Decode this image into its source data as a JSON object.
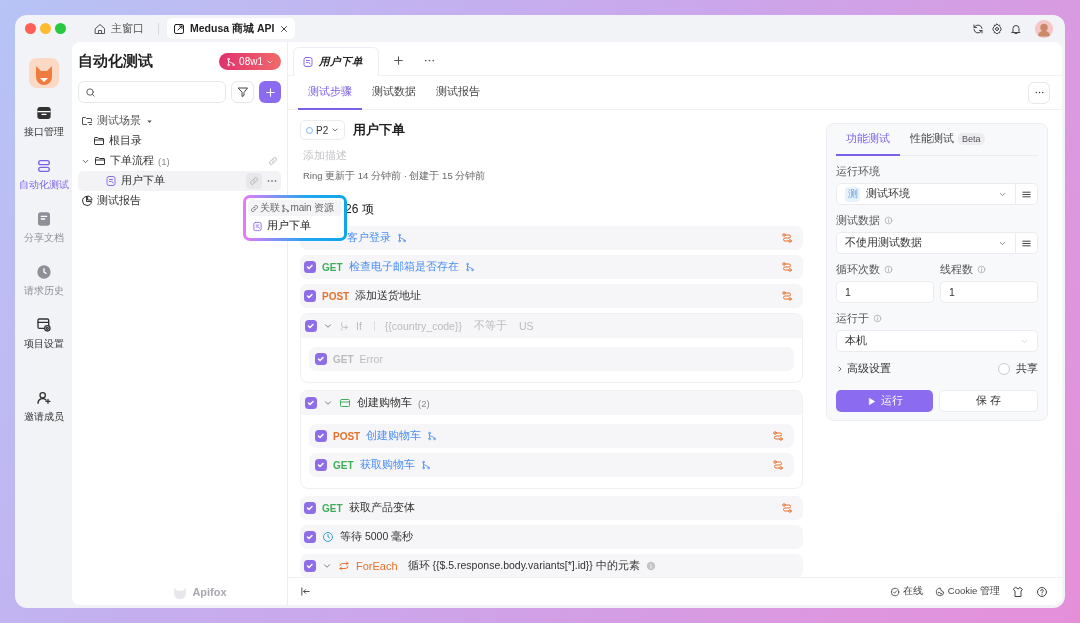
{
  "window": {
    "tabs": [
      {
        "kind": "home",
        "label": "主窗口",
        "selected": false,
        "closable": false
      },
      {
        "kind": "project",
        "label": "Medusa 商城 API",
        "selected": true,
        "closable": true
      }
    ]
  },
  "nav": [
    {
      "label": "接口管理",
      "selected": false,
      "disabled": false
    },
    {
      "label": "自动化测试",
      "selected": true,
      "disabled": false
    },
    {
      "label": "分享文档",
      "selected": false,
      "disabled": true
    },
    {
      "label": "请求历史",
      "selected": false,
      "disabled": true
    },
    {
      "label": "项目设置",
      "selected": false,
      "disabled": false
    },
    {
      "label": "邀请成员",
      "selected": false,
      "disabled": false
    }
  ],
  "sidebar": {
    "title": "自动化测试",
    "branch": "08w1",
    "footer_logo": "Apifox",
    "tree": [
      {
        "kind": "section",
        "label": "测试场景",
        "expanded": true,
        "children": [
          {
            "kind": "folder",
            "label": "根目录",
            "selected": false
          },
          {
            "kind": "folder",
            "label": "下单流程",
            "count": "(1)",
            "expanded": true,
            "selected": false,
            "children": [
              {
                "kind": "scenario",
                "label": "用户下单",
                "selected": true
              }
            ]
          }
        ]
      },
      {
        "kind": "report",
        "label": "测试报告"
      }
    ]
  },
  "popup": {
    "link_label": "关联",
    "link_target": "main 资源",
    "item": "用户下单"
  },
  "editor": {
    "tabs": [
      {
        "label": "用户下单",
        "selected": true
      }
    ],
    "subtabs": [
      {
        "label": "测试步骤",
        "selected": true
      },
      {
        "label": "测试数据",
        "selected": false
      },
      {
        "label": "测试报告",
        "selected": false
      }
    ],
    "priority": "P2",
    "title": "用户下单",
    "description_placeholder": "添加描述",
    "meta": "Ring 更新于 14 分钟前 · 创建于 15 分钟前",
    "count": "26 项",
    "steps": [
      {
        "kind": "request",
        "name": "客户登录",
        "linked": true,
        "disabled": false
      },
      {
        "kind": "request",
        "checked": true,
        "method": "GET",
        "name": "检查电子邮箱是否存在",
        "linked": true,
        "disabled": false
      },
      {
        "kind": "request",
        "checked": true,
        "method": "POST",
        "name": "添加送货地址",
        "linked": false,
        "disabled": false
      },
      {
        "kind": "if",
        "checked": true,
        "expanded": true,
        "keyword": "If",
        "left": "{{country_code}}",
        "operator": "不等于",
        "right": "US",
        "children": [
          {
            "kind": "request",
            "checked": true,
            "method": "GET",
            "name": "Error",
            "linked": false,
            "disabled": true
          }
        ]
      },
      {
        "kind": "group",
        "checked": true,
        "expanded": true,
        "name": "创建购物车",
        "count": "(2)",
        "children": [
          {
            "kind": "request",
            "checked": true,
            "method": "POST",
            "name": "创建购物车",
            "linked": true,
            "disabled": false
          },
          {
            "kind": "request",
            "checked": true,
            "method": "GET",
            "name": "获取购物车",
            "linked": true,
            "disabled": false
          }
        ]
      },
      {
        "kind": "request",
        "checked": true,
        "method": "GET",
        "name": "获取产品变体",
        "linked": false,
        "disabled": false
      },
      {
        "kind": "wait",
        "checked": true,
        "text": "等待 5000 毫秒"
      },
      {
        "kind": "foreach",
        "checked": true,
        "expanded": true,
        "keyword": "ForEach",
        "text": "循环 {{$.5.response.body.variants[*].id}} 中的元素"
      }
    ]
  },
  "run_panel": {
    "tabs": [
      {
        "label": "功能测试",
        "selected": true
      },
      {
        "label": "性能测试",
        "badge": "Beta",
        "selected": false
      }
    ],
    "env_label": "运行环境",
    "env_badge": "测",
    "env_value": "测试环境",
    "data_label": "测试数据",
    "data_value": "不使用测试数据",
    "loops_label": "循环次数",
    "loops_value": "1",
    "threads_label": "线程数",
    "threads_value": "1",
    "run_on_label": "运行于",
    "run_on_value": "本机",
    "advanced": {
      "label": "高级设置",
      "expanded": false
    },
    "share": {
      "label": "共享",
      "checked": false
    },
    "run_button": "运行",
    "save_button": "保 存"
  },
  "status_bar": {
    "online": "在线",
    "cookie": "Cookie 管理"
  }
}
